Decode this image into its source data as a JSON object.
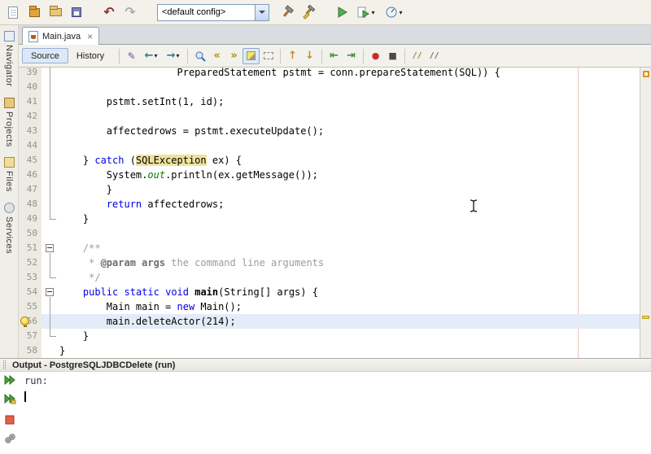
{
  "main_toolbar": {
    "config_value": "<default config>",
    "icons": {
      "undo": "↶",
      "redo": "↷",
      "new_file": "page-shape",
      "new_project": "box-shape",
      "open_project": "folder-shape",
      "save_all": "floppy-stack-shape",
      "build": "hammer-shape",
      "clean_build": "hammer-broom-shape",
      "run": "green-triangle",
      "debug": "page-play-shape",
      "profile": "dial-shape",
      "dropdown_arrow": "▾"
    }
  },
  "tabs": {
    "active": "Main.java",
    "close": "×"
  },
  "editor_toolbar": {
    "source": "Source",
    "history": "History",
    "icons": {
      "last_edit": "✎",
      "back": "←",
      "forward": "→",
      "find_prev": "«",
      "find_next": "»",
      "prev_bookmark": "↑",
      "next_bookmark": "↓",
      "shift_left": "⇤",
      "shift_right": "⇥",
      "record_macro": "●",
      "stop_macro": "■",
      "comment": "//",
      "uncomment": "//"
    }
  },
  "sidebar": {
    "items": [
      "Navigator",
      "Projects",
      "Files",
      "Services"
    ]
  },
  "editor": {
    "highlight_color": "#e3ecf7",
    "occurrence_color": "#efe39c",
    "keyword_color": "#0000e6",
    "lines": [
      {
        "no": "39",
        "fold": "line",
        "segs": [
          [
            "p",
            "                    PreparedStatement pstmt = conn.prepareStatement(SQL)) {"
          ]
        ]
      },
      {
        "no": "40",
        "fold": "line",
        "segs": []
      },
      {
        "no": "41",
        "fold": "line",
        "segs": [
          [
            "p",
            "        pstmt.setInt(1, id);"
          ]
        ]
      },
      {
        "no": "42",
        "fold": "line",
        "segs": []
      },
      {
        "no": "43",
        "fold": "line",
        "segs": [
          [
            "p",
            "        affectedrows = pstmt.executeUpdate();"
          ]
        ]
      },
      {
        "no": "44",
        "fold": "line",
        "segs": []
      },
      {
        "no": "45",
        "fold": "line",
        "segs": [
          [
            "p",
            "    } "
          ],
          [
            "k",
            "catch"
          ],
          [
            "p",
            " ("
          ],
          [
            "hl",
            "SQLException"
          ],
          [
            "p",
            " ex) {"
          ]
        ]
      },
      {
        "no": "46",
        "fold": "line",
        "segs": [
          [
            "p",
            "        System."
          ],
          [
            "f",
            "out"
          ],
          [
            "p",
            ".println(ex.getMessage());"
          ]
        ]
      },
      {
        "no": "47",
        "fold": "line",
        "segs": [
          [
            "p",
            "        }"
          ]
        ]
      },
      {
        "no": "48",
        "fold": "line",
        "segs": [
          [
            "p",
            "        "
          ],
          [
            "k",
            "return"
          ],
          [
            "p",
            " affectedrows;"
          ]
        ]
      },
      {
        "no": "49",
        "fold": "end",
        "segs": [
          [
            "p",
            "    }"
          ]
        ]
      },
      {
        "no": "50",
        "fold": "",
        "segs": []
      },
      {
        "no": "51",
        "fold": "box",
        "segs": [
          [
            "c",
            "    /**"
          ]
        ]
      },
      {
        "no": "52",
        "fold": "line",
        "segs": [
          [
            "c",
            "     * "
          ],
          [
            "t",
            "@param args"
          ],
          [
            "c",
            " the command line arguments"
          ]
        ]
      },
      {
        "no": "53",
        "fold": "end",
        "segs": [
          [
            "c",
            "     */"
          ]
        ]
      },
      {
        "no": "54",
        "fold": "box",
        "segs": [
          [
            "p",
            "    "
          ],
          [
            "k",
            "public"
          ],
          [
            "p",
            " "
          ],
          [
            "k",
            "static"
          ],
          [
            "p",
            " "
          ],
          [
            "k",
            "void"
          ],
          [
            "p",
            " "
          ],
          [
            "b",
            "main"
          ],
          [
            "p",
            "(String[] args) {"
          ]
        ]
      },
      {
        "no": "55",
        "fold": "line",
        "segs": [
          [
            "p",
            "        Main main = "
          ],
          [
            "k",
            "new"
          ],
          [
            "p",
            " Main();"
          ]
        ]
      },
      {
        "no": "56",
        "fold": "line",
        "active": true,
        "bulb": true,
        "segs": [
          [
            "p",
            "        main.deleteActor(214);"
          ]
        ]
      },
      {
        "no": "57",
        "fold": "end",
        "segs": [
          [
            "p",
            "    }"
          ]
        ]
      },
      {
        "no": "58",
        "fold": "",
        "segs": [
          [
            "p",
            "}"
          ]
        ]
      }
    ]
  },
  "output": {
    "title": "Output - PostgreSQLJDBCDelete (run)",
    "line1": "run:"
  }
}
